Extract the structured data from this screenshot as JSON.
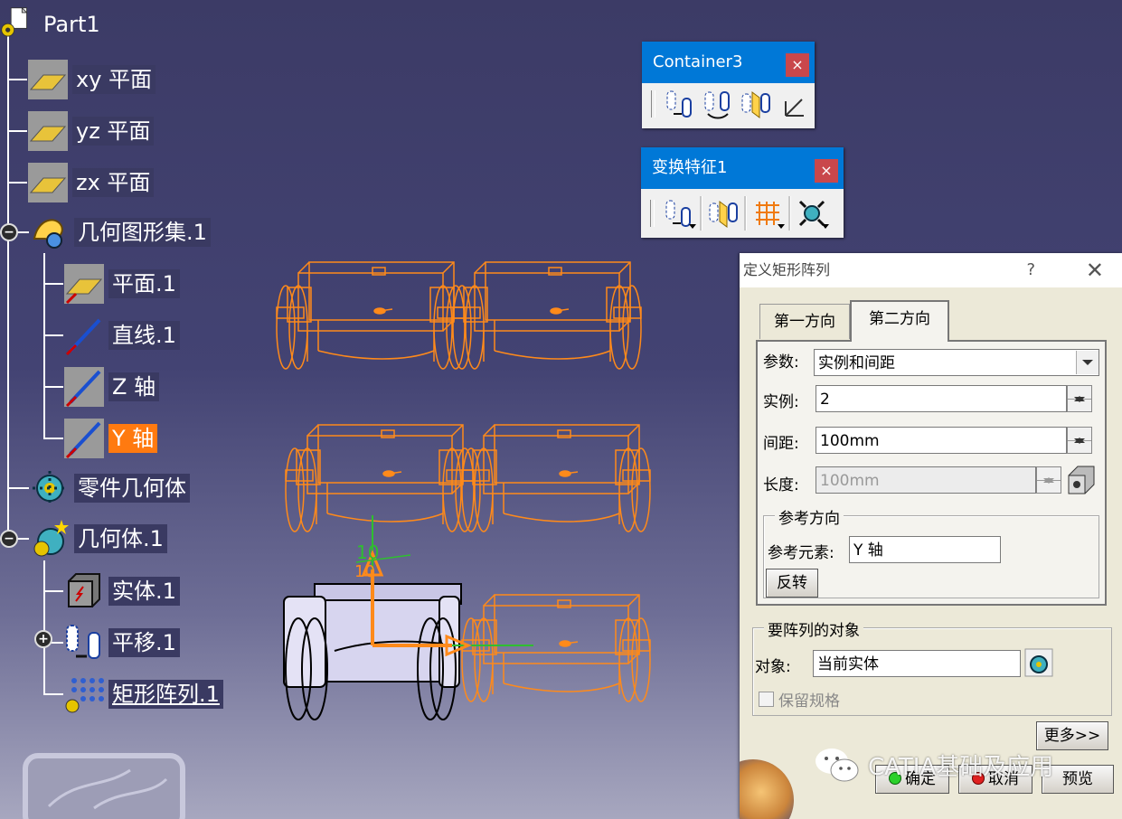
{
  "tree": {
    "root": "Part1",
    "items": [
      {
        "label": "xy 平面"
      },
      {
        "label": "yz 平面"
      },
      {
        "label": "zx 平面"
      },
      {
        "label": "几何图形集.1"
      },
      {
        "label": "平面.1"
      },
      {
        "label": "直线.1"
      },
      {
        "label": "Z 轴"
      },
      {
        "label": "Y 轴",
        "selected": true
      },
      {
        "label": "零件几何体"
      },
      {
        "label": "几何体.1"
      },
      {
        "label": "实体.1"
      },
      {
        "label": "平移.1"
      },
      {
        "label": "矩形阵列.1"
      }
    ],
    "selection_color": "#ff7a10"
  },
  "toolbars": {
    "container3": {
      "title": "Container3",
      "close": "×"
    },
    "transform": {
      "title": "变换特征1",
      "close": "×"
    }
  },
  "viewport": {
    "axis_label_x": "10",
    "axis_label_y": "10",
    "pattern_color": "#ff8a1a",
    "axis_color": "#2fbf2f"
  },
  "dialog": {
    "title": "定义矩形阵列",
    "help": "?",
    "close": "✕",
    "tabs": [
      "第一方向",
      "第二方向"
    ],
    "active_tab": 1,
    "params_label": "参数:",
    "params_value": "实例和间距",
    "instances_label": "实例:",
    "instances_value": "2",
    "spacing_label": "间距:",
    "spacing_value": "100mm",
    "length_label": "长度:",
    "length_value": "100mm",
    "ref_group_title": "参考方向",
    "ref_element_label": "参考元素:",
    "ref_element_value": "Y 轴",
    "reverse_button": "反转",
    "object_group_title": "要阵列的对象",
    "object_label": "对象:",
    "object_value": "当前实体",
    "keep_spec_label": "保留规格",
    "more_button": "更多>>",
    "ok_button": "确定",
    "cancel_button": "取消",
    "preview_button": "预览"
  },
  "watermark": {
    "text": "CATIA基础及应用"
  }
}
